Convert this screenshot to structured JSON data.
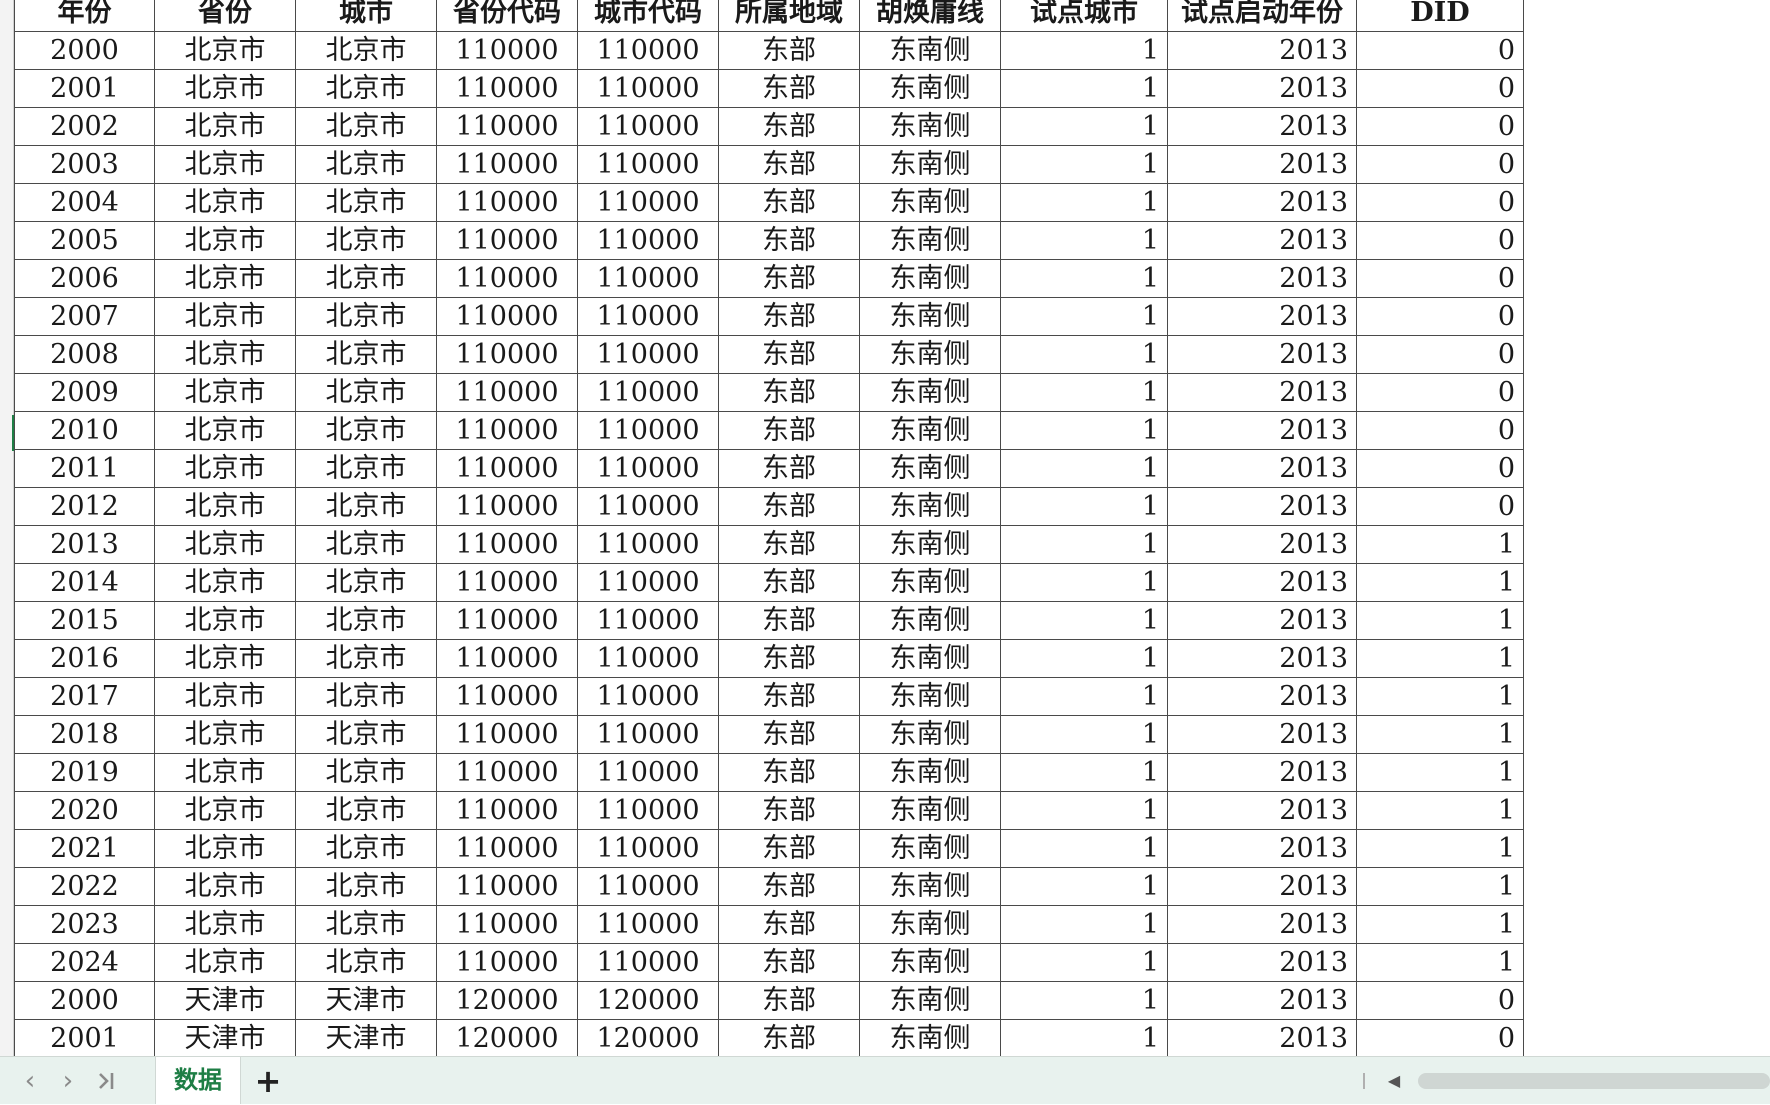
{
  "sheet": {
    "columns": [
      "年份",
      "省份",
      "城市",
      "省份代码",
      "城市代码",
      "所属地域",
      "胡焕庸线",
      "试点城市",
      "试点启动年份",
      "DID"
    ],
    "rows": [
      [
        "2000",
        "北京市",
        "北京市",
        "110000",
        "110000",
        "东部",
        "东南侧",
        "1",
        "2013",
        "0"
      ],
      [
        "2001",
        "北京市",
        "北京市",
        "110000",
        "110000",
        "东部",
        "东南侧",
        "1",
        "2013",
        "0"
      ],
      [
        "2002",
        "北京市",
        "北京市",
        "110000",
        "110000",
        "东部",
        "东南侧",
        "1",
        "2013",
        "0"
      ],
      [
        "2003",
        "北京市",
        "北京市",
        "110000",
        "110000",
        "东部",
        "东南侧",
        "1",
        "2013",
        "0"
      ],
      [
        "2004",
        "北京市",
        "北京市",
        "110000",
        "110000",
        "东部",
        "东南侧",
        "1",
        "2013",
        "0"
      ],
      [
        "2005",
        "北京市",
        "北京市",
        "110000",
        "110000",
        "东部",
        "东南侧",
        "1",
        "2013",
        "0"
      ],
      [
        "2006",
        "北京市",
        "北京市",
        "110000",
        "110000",
        "东部",
        "东南侧",
        "1",
        "2013",
        "0"
      ],
      [
        "2007",
        "北京市",
        "北京市",
        "110000",
        "110000",
        "东部",
        "东南侧",
        "1",
        "2013",
        "0"
      ],
      [
        "2008",
        "北京市",
        "北京市",
        "110000",
        "110000",
        "东部",
        "东南侧",
        "1",
        "2013",
        "0"
      ],
      [
        "2009",
        "北京市",
        "北京市",
        "110000",
        "110000",
        "东部",
        "东南侧",
        "1",
        "2013",
        "0"
      ],
      [
        "2010",
        "北京市",
        "北京市",
        "110000",
        "110000",
        "东部",
        "东南侧",
        "1",
        "2013",
        "0"
      ],
      [
        "2011",
        "北京市",
        "北京市",
        "110000",
        "110000",
        "东部",
        "东南侧",
        "1",
        "2013",
        "0"
      ],
      [
        "2012",
        "北京市",
        "北京市",
        "110000",
        "110000",
        "东部",
        "东南侧",
        "1",
        "2013",
        "0"
      ],
      [
        "2013",
        "北京市",
        "北京市",
        "110000",
        "110000",
        "东部",
        "东南侧",
        "1",
        "2013",
        "1"
      ],
      [
        "2014",
        "北京市",
        "北京市",
        "110000",
        "110000",
        "东部",
        "东南侧",
        "1",
        "2013",
        "1"
      ],
      [
        "2015",
        "北京市",
        "北京市",
        "110000",
        "110000",
        "东部",
        "东南侧",
        "1",
        "2013",
        "1"
      ],
      [
        "2016",
        "北京市",
        "北京市",
        "110000",
        "110000",
        "东部",
        "东南侧",
        "1",
        "2013",
        "1"
      ],
      [
        "2017",
        "北京市",
        "北京市",
        "110000",
        "110000",
        "东部",
        "东南侧",
        "1",
        "2013",
        "1"
      ],
      [
        "2018",
        "北京市",
        "北京市",
        "110000",
        "110000",
        "东部",
        "东南侧",
        "1",
        "2013",
        "1"
      ],
      [
        "2019",
        "北京市",
        "北京市",
        "110000",
        "110000",
        "东部",
        "东南侧",
        "1",
        "2013",
        "1"
      ],
      [
        "2020",
        "北京市",
        "北京市",
        "110000",
        "110000",
        "东部",
        "东南侧",
        "1",
        "2013",
        "1"
      ],
      [
        "2021",
        "北京市",
        "北京市",
        "110000",
        "110000",
        "东部",
        "东南侧",
        "1",
        "2013",
        "1"
      ],
      [
        "2022",
        "北京市",
        "北京市",
        "110000",
        "110000",
        "东部",
        "东南侧",
        "1",
        "2013",
        "1"
      ],
      [
        "2023",
        "北京市",
        "北京市",
        "110000",
        "110000",
        "东部",
        "东南侧",
        "1",
        "2013",
        "1"
      ],
      [
        "2024",
        "北京市",
        "北京市",
        "110000",
        "110000",
        "东部",
        "东南侧",
        "1",
        "2013",
        "1"
      ],
      [
        "2000",
        "天津市",
        "天津市",
        "120000",
        "120000",
        "东部",
        "东南侧",
        "1",
        "2013",
        "0"
      ],
      [
        "2001",
        "天津市",
        "天津市",
        "120000",
        "120000",
        "东部",
        "东南侧",
        "1",
        "2013",
        "0"
      ]
    ]
  },
  "tabbar": {
    "nav_icons": [
      "chevron-left-icon",
      "chevron-right-icon",
      "last-sheet-icon",
      "scroll-left-icon"
    ],
    "sheet_tab": "数据",
    "add_icon": "plus-icon",
    "accent_color": "#1e7e45"
  }
}
